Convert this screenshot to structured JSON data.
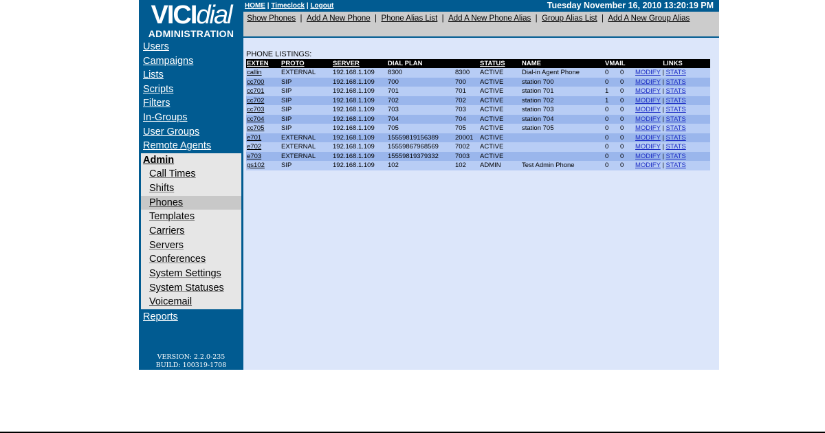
{
  "logo": {
    "brand_a": "VICI",
    "brand_b": "dial",
    "subtitle": "ADMINISTRATION"
  },
  "sidebar": {
    "items": [
      "Users",
      "Campaigns",
      "Lists",
      "Scripts",
      "Filters",
      "In-Groups",
      "User Groups",
      "Remote Agents"
    ],
    "admin_label": "Admin",
    "admin_items": [
      "Call Times",
      "Shifts",
      "Phones",
      "Templates",
      "Carriers",
      "Servers",
      "Conferences",
      "System Settings",
      "System Statuses",
      "Voicemail"
    ],
    "active_admin_item": "Phones",
    "reports_label": "Reports",
    "version": "VERSION: 2.2.0-235",
    "build": "BUILD: 100319-1708"
  },
  "topbar": {
    "links": [
      "HOME",
      "Timeclock",
      "Logout"
    ],
    "datetime": "Tuesday November 16, 2010 13:20:19 PM"
  },
  "subnav": {
    "links": [
      "Show Phones",
      "Add A New Phone",
      "Phone Alias List",
      "Add A New Phone Alias",
      "Group Alias List",
      "Add A New Group Alias"
    ]
  },
  "listing": {
    "title": "PHONE LISTINGS:",
    "columns": [
      "EXTEN",
      "PROTO",
      "SERVER",
      "DIAL PLAN",
      "STATUS",
      "NAME",
      "VMAIL",
      "LINKS"
    ],
    "link_modify": "MODIFY",
    "link_stats": "STATS",
    "rows": [
      {
        "exten": "callin",
        "proto": "EXTERNAL",
        "server": "192.168.1.109",
        "dialplan": "8300",
        "ext2": "8300",
        "status": "ACTIVE",
        "name": "Dial-in Agent Phone",
        "vm1": "0",
        "vm2": "0"
      },
      {
        "exten": "cc700",
        "proto": "SIP",
        "server": "192.168.1.109",
        "dialplan": "700",
        "ext2": "700",
        "status": "ACTIVE",
        "name": "station 700",
        "vm1": "0",
        "vm2": "0"
      },
      {
        "exten": "cc701",
        "proto": "SIP",
        "server": "192.168.1.109",
        "dialplan": "701",
        "ext2": "701",
        "status": "ACTIVE",
        "name": "station 701",
        "vm1": "1",
        "vm2": "0"
      },
      {
        "exten": "cc702",
        "proto": "SIP",
        "server": "192.168.1.109",
        "dialplan": "702",
        "ext2": "702",
        "status": "ACTIVE",
        "name": "station 702",
        "vm1": "1",
        "vm2": "0"
      },
      {
        "exten": "cc703",
        "proto": "SIP",
        "server": "192.168.1.109",
        "dialplan": "703",
        "ext2": "703",
        "status": "ACTIVE",
        "name": "station 703",
        "vm1": "0",
        "vm2": "0"
      },
      {
        "exten": "cc704",
        "proto": "SIP",
        "server": "192.168.1.109",
        "dialplan": "704",
        "ext2": "704",
        "status": "ACTIVE",
        "name": "station 704",
        "vm1": "0",
        "vm2": "0"
      },
      {
        "exten": "cc705",
        "proto": "SIP",
        "server": "192.168.1.109",
        "dialplan": "705",
        "ext2": "705",
        "status": "ACTIVE",
        "name": "station 705",
        "vm1": "0",
        "vm2": "0"
      },
      {
        "exten": "e701",
        "proto": "EXTERNAL",
        "server": "192.168.1.109",
        "dialplan": "15559819156389",
        "ext2": "20001",
        "status": "ACTIVE",
        "name": "",
        "vm1": "0",
        "vm2": "0"
      },
      {
        "exten": "e702",
        "proto": "EXTERNAL",
        "server": "192.168.1.109",
        "dialplan": "15559867968569",
        "ext2": "7002",
        "status": "ACTIVE",
        "name": "",
        "vm1": "0",
        "vm2": "0"
      },
      {
        "exten": "e703",
        "proto": "EXTERNAL",
        "server": "192.168.1.109",
        "dialplan": "15559819379332",
        "ext2": "7003",
        "status": "ACTIVE",
        "name": "",
        "vm1": "0",
        "vm2": "0"
      },
      {
        "exten": "gs102",
        "proto": "SIP",
        "server": "192.168.1.109",
        "dialplan": "102",
        "ext2": "102",
        "status": "ADMIN",
        "name": "Test Admin Phone",
        "vm1": "0",
        "vm2": "0"
      }
    ]
  },
  "colors": {
    "brand_blue": "#015b91",
    "content_bg": "#dce6fa",
    "row_light": "#b8cdf5",
    "row_dark": "#9ab6ec",
    "link_blue": "#1b2cc4"
  }
}
